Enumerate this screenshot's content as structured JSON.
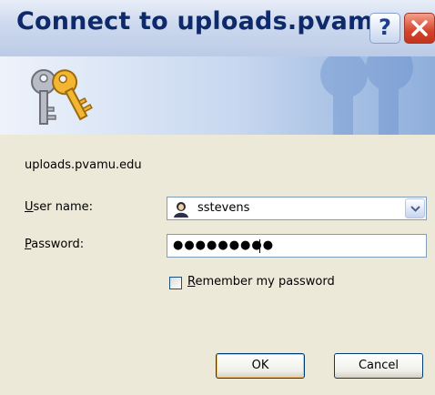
{
  "window": {
    "title": "Connect to uploads.pvam...",
    "help_button": "?"
  },
  "server": "uploads.pvamu.edu",
  "form": {
    "username_label_mnemonic": "U",
    "username_label_rest": "ser name:",
    "username_value": "sstevens",
    "password_label_mnemonic": "P",
    "password_label_rest": "assword:",
    "password_masked": "●●●●●●●●●",
    "remember_mnemonic": "R",
    "remember_rest": "emember my password",
    "remember_checked": false
  },
  "buttons": {
    "ok": "OK",
    "cancel": "Cancel"
  },
  "icons": {
    "banner": "keys-icon",
    "user": "user-avatar-icon",
    "dropdown": "chevron-down-icon",
    "close": "close-icon",
    "help": "help-icon"
  },
  "colors": {
    "title_text": "#0f2a6b",
    "dialog_bg": "#ece9d8",
    "close_button": "#d6432c"
  }
}
